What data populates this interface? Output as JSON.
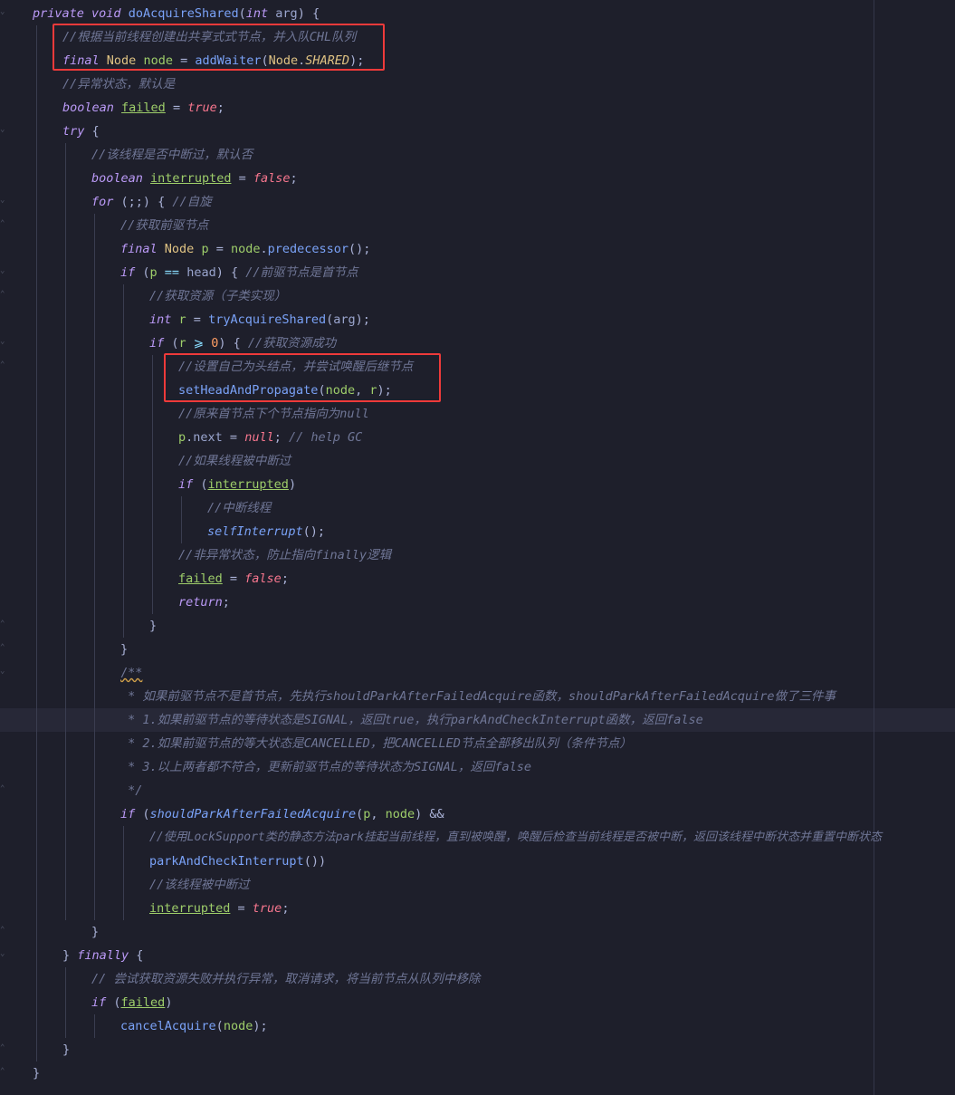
{
  "colors": {
    "background": "#1e1f2b",
    "highlight_box": "#ee3a3a",
    "keyword": "#bb9af7",
    "type": "#e0c383",
    "function": "#7aa2f7",
    "variable": "#9ece6a",
    "boolean": "#f7768e",
    "comment": "#6f7696"
  },
  "code": {
    "l01": [
      "private",
      " ",
      "void",
      " ",
      "doAcquireShared",
      "(",
      "int",
      " ",
      "arg",
      ") {"
    ],
    "l02": "//根据当前线程创建出共享式式节点，并入队CHL队列",
    "l03": [
      "final",
      " ",
      "Node",
      " ",
      "node",
      " = ",
      "addWaiter",
      "(",
      "Node",
      ".",
      "SHARED",
      ");"
    ],
    "l04": "//异常状态，默认是",
    "l05": [
      "boolean",
      " ",
      "failed",
      " = ",
      "true",
      ";"
    ],
    "l06": [
      "try",
      " {"
    ],
    "l07": "//该线程是否中断过，默认否",
    "l08": [
      "boolean",
      " ",
      "interrupted",
      " = ",
      "false",
      ";"
    ],
    "l09": [
      "for",
      " (;;) { ",
      "//自旋"
    ],
    "l10": "//获取前驱节点",
    "l11": [
      "final",
      " ",
      "Node",
      " ",
      "p",
      " = ",
      "node",
      ".",
      "predecessor",
      "();"
    ],
    "l12": [
      "if",
      " (",
      "p",
      " == ",
      "head",
      ") { ",
      "//前驱节点是首节点"
    ],
    "l13": "//获取资源（子类实现）",
    "l14": [
      "int",
      " ",
      "r",
      " = ",
      "tryAcquireShared",
      "(",
      "arg",
      ");"
    ],
    "l15": [
      "if",
      " (",
      "r",
      " ⩾ ",
      "0",
      ") { ",
      "//获取资源成功"
    ],
    "l16": "//设置自己为头结点，并尝试唤醒后继节点",
    "l17": [
      "setHeadAndPropagate",
      "(",
      "node",
      ", ",
      "r",
      ");"
    ],
    "l18": "//原来首节点下个节点指向为null",
    "l19": [
      "p",
      ".",
      "next",
      " = ",
      "null",
      "; ",
      "// help GC"
    ],
    "l20": "//如果线程被中断过",
    "l21": [
      "if",
      " (",
      "interrupted",
      ")"
    ],
    "l22": "//中断线程",
    "l23": [
      "selfInterrupt",
      "();"
    ],
    "l24": "//非异常状态，防止指向finally逻辑",
    "l25": [
      "failed",
      " = ",
      "false",
      ";"
    ],
    "l26": [
      "return",
      ";"
    ],
    "l27": "}",
    "l28": "}",
    "l29": "/**",
    "l30": " * 如果前驱节点不是首节点，先执行shouldParkAfterFailedAcquire函数，shouldParkAfterFailedAcquire做了三件事",
    "l31": " * 1.如果前驱节点的等待状态是SIGNAL，返回true，执行parkAndCheckInterrupt函数，返回false",
    "l32": " * 2.如果前驱节点的等大状态是CANCELLED，把CANCELLED节点全部移出队列（条件节点）",
    "l33": " * 3.以上两者都不符合，更新前驱节点的等待状态为SIGNAL，返回false",
    "l34": " */",
    "l35": [
      "if",
      " (",
      "shouldParkAfterFailedAcquire",
      "(",
      "p",
      ", ",
      "node",
      ") &&"
    ],
    "l36": "//使用LockSupport类的静态方法park挂起当前线程，直到被唤醒，唤醒后检查当前线程是否被中断，返回该线程中断状态并重置中断状态",
    "l37": [
      "parkAndCheckInterrupt",
      "())"
    ],
    "l38": "//该线程被中断过",
    "l39": [
      "interrupted",
      " = ",
      "true",
      ";"
    ],
    "l40": "}",
    "l41": [
      "} ",
      "finally",
      " {"
    ],
    "l42": "// 尝试获取资源失败并执行异常，取消请求，将当前节点从队列中移除",
    "l43": [
      "if",
      " (",
      "failed",
      ")"
    ],
    "l44": [
      "cancelAcquire",
      "(",
      "node",
      ");"
    ],
    "l45": "}",
    "l46": "}"
  }
}
